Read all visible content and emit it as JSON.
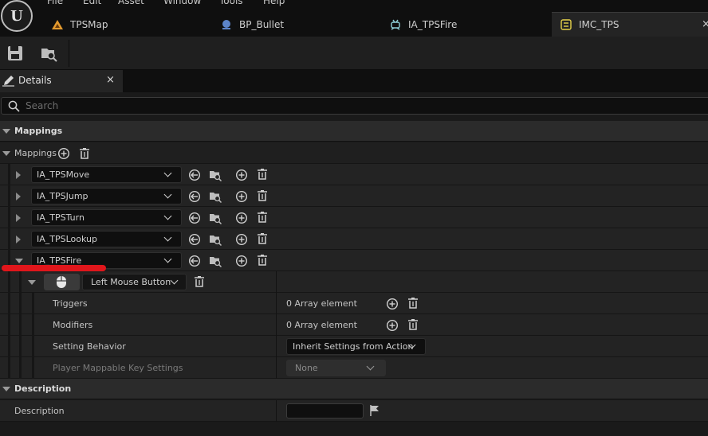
{
  "menu": [
    "File",
    "Edit",
    "Asset",
    "Window",
    "Tools",
    "Help"
  ],
  "tabs": [
    {
      "label": "TPSMap",
      "icon": "level-icon"
    },
    {
      "label": "BP_Bullet",
      "icon": "blueprint-icon"
    },
    {
      "label": "IA_TPSFire",
      "icon": "input-action-icon"
    },
    {
      "label": "IMC_TPS",
      "icon": "input-mapping-context-icon",
      "active": true
    }
  ],
  "tab_close": "×",
  "details": {
    "title": "Details",
    "close": "×"
  },
  "search": {
    "placeholder": "Search"
  },
  "sections": {
    "mappings": "Mappings",
    "description": "Description"
  },
  "mappings_header": "Mappings",
  "mappings": [
    {
      "action": "IA_TPSMove",
      "expanded": false
    },
    {
      "action": "IA_TPSJump",
      "expanded": false
    },
    {
      "action": "IA_TPSTurn",
      "expanded": false
    },
    {
      "action": "IA_TPSLookup",
      "expanded": false
    },
    {
      "action": "IA_TPSFire",
      "expanded": true
    }
  ],
  "key_mapping": {
    "key": "Left Mouse Button",
    "icon": "mouse-icon"
  },
  "properties": [
    {
      "label": "Triggers",
      "value": "0 Array element"
    },
    {
      "label": "Modifiers",
      "value": "0 Array element"
    },
    {
      "label": "Setting Behavior",
      "value": "Inherit Settings from Action"
    },
    {
      "label": "Player Mappable Key Settings",
      "value": "None"
    }
  ],
  "description_row": {
    "label": "Description",
    "value": ""
  },
  "colors": {
    "annotation": "#e0161b",
    "panel": "#1a1a1a",
    "row": "#232323",
    "section": "#2b2b2b"
  }
}
